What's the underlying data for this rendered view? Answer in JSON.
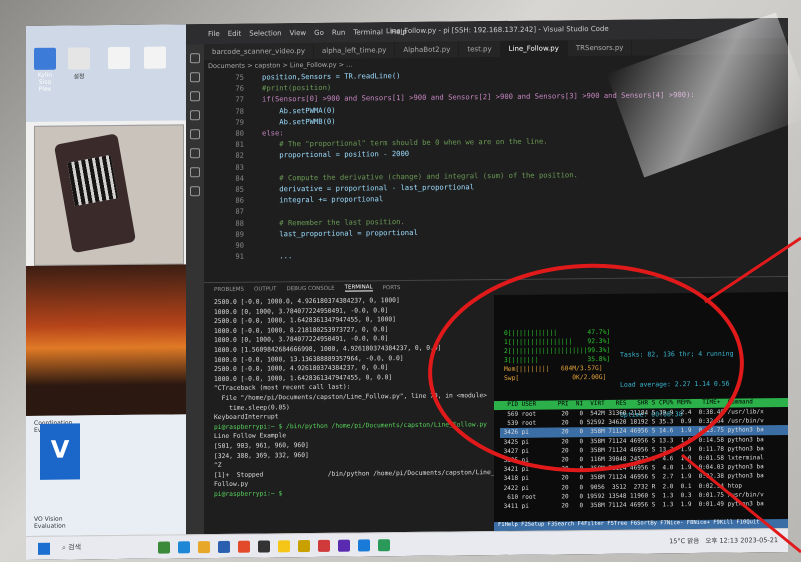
{
  "window": {
    "title": "Line_Follow.py - pi [SSH: 192.168.137.242] - Visual Studio Code"
  },
  "menu": [
    "File",
    "Edit",
    "Selection",
    "View",
    "Go",
    "Run",
    "Terminal",
    "Help"
  ],
  "tabs": [
    "barcode_scanner_video.py",
    "alpha_left_time.py",
    "AlphaBot2.py",
    "test.py",
    "Line_Follow.py",
    "TRSensors.py"
  ],
  "breadcrumb": "Documents > capston > Line_Follow.py > ...",
  "editor": {
    "line_numbers": [
      "75",
      "76",
      "77",
      "78",
      "79",
      "80",
      "81",
      "82",
      "83",
      "84",
      "85",
      "86",
      "87",
      "88",
      "89",
      "90",
      "91"
    ],
    "lines": [
      "position,Sensors = TR.readLine()",
      "#print(position)",
      "if(Sensors[0] >900 and Sensors[1] >900 and Sensors[2] >900 and Sensors[3] >900 and Sensors[4] >900):",
      "    Ab.setPWMA(0)",
      "    Ab.setPWMB(0)",
      "else:",
      "    # The \"proportional\" term should be 0 when we are on the line.",
      "    proportional = position - 2000",
      "",
      "    # Compute the derivative (change) and integral (sum) of the position.",
      "    derivative = proportional - last_proportional",
      "    integral += proportional",
      "",
      "    # Remember the last position.",
      "    last_proportional = proportional",
      "",
      "    ..."
    ]
  },
  "panel_tabs": [
    "PROBLEMS",
    "OUTPUT",
    "DEBUG CONSOLE",
    "TERMINAL",
    "PORTS"
  ],
  "terminal": {
    "lines": [
      "2500.0 [-0.0, 1000.0, 4.926180374384237, 0, 1000]",
      "1000.0 [0, 1000, 3.784077224950491, -0.0, 0.0]",
      "2500.0 [-0.0, 1000, 1.6428361347947455, 0, 1000]",
      "1000.0 [-0.0, 1000, 8.218180253973727, 0, 0.0]",
      "1000.0 [0, 1000, 3.784077224950491, -0.0, 0.0]",
      "1000.0 [1.5609842684666998, 1000, 4.926180374384237, 0, 0.0]",
      "1000.0 [-0.0, 1000, 13.136388889357964, -0.0, 0.0]",
      "2500.0 [-0.0, 1000, 4.926180374384237, 0, 0.0]",
      "1000.0 [-0.0, 1000, 1.6428361347947455, 0, 0.0]",
      "^CTraceback (most recent call last):",
      "  File \"/home/pi/Documents/capston/Line_Follow.py\", line 70, in <module>",
      "    time.sleep(0.05)",
      "KeyboardInterrupt",
      "",
      "pi@raspberrypi:~ $ /bin/python /home/pi/Documents/capston/Line_Follow.py",
      "Line Follow Example",
      "[501, 903, 961, 960, 960]",
      "[324, 388, 369, 332, 960]",
      "^Z",
      "[1]+  Stopped                 /bin/python /home/pi/Documents/capston/Line_",
      "Follow.py",
      "pi@raspberrypi:~ $ "
    ]
  },
  "htop": {
    "cpu_lines": [
      "0[||||||||||||        47.7%]",
      "1[||||||||||||||||    92.3%]",
      "2[||||||||||||||||||||99.3%]",
      "3[|||||||             35.8%]",
      "Mem[||||||||   604M/3.57G]",
      "Swp[              0K/2.00G]"
    ],
    "tasks": "Tasks: 82, 136 thr; 4 running",
    "load": "Load average: 2.27 1.14 0.56",
    "uptime": "Uptime: 00:08:38",
    "header": "  PID USER      PRI  NI  VIRT   RES   SHR S CPU% MEM%   TIME+  Command",
    "rows": [
      "  569 root       20   0  542M 31360 21184 S 39.9  2.4  0:38.40 /usr/lib/x",
      "  539 root       20   0 52592 34620 18192 S 35.3  0.9  0:32.64 /usr/bin/v",
      " 3426 pi         20   0  358M 71124 46956 S 14.6  1.9  0:13.75 python3 ba",
      " 3425 pi         20   0  358M 71124 46956 S 13.3  1.9  0:14.58 python3 ba",
      " 3427 pi         20   0  358M 71124 46956 S 13.3  1.9  0:11.78 python3 ba",
      " 3335 pi         20   0  116M 39048 24572 S  4.6  1.0  0:01.58 lxterminal",
      " 3421 pi         20   0  358M 71124 46956 S  4.0  1.9  0:04.03 python3 ba",
      " 3418 pi         20   0  358M 71124 46956 S  2.7  1.9  0:02.38 python3 ba",
      " 2422 pi         20   0  9056  3512  2732 R  2.0  0.1  0:02.94 htop",
      "  610 root       20   0 19592 13548 11960 S  1.3  0.3  0:01.75 /usr/bin/v",
      " 3411 pi         20   0  358M 71124 46956 S  1.3  1.9  0:01.49 python3 ba"
    ],
    "fkeys": "F1Help F2Setup F3Search F4Filter F5Tree F6SortBy F7Nice- F8Nice+ F9Kill F10Quit"
  },
  "desktop": {
    "icon1": "Kylin Siso Plex",
    "icon2": "설정",
    "app1": "Coordination Evaluation",
    "app2": "VO Vision Evaluation"
  },
  "taskbar": {
    "search": "검색",
    "weather": "15°C 맑음",
    "clock": "오후 12:13\n2023-05-21"
  },
  "colors": {
    "annotation": "#e01a1a",
    "vscode_bg": "#1e1e1e",
    "htop_header": "#2bb04a"
  }
}
